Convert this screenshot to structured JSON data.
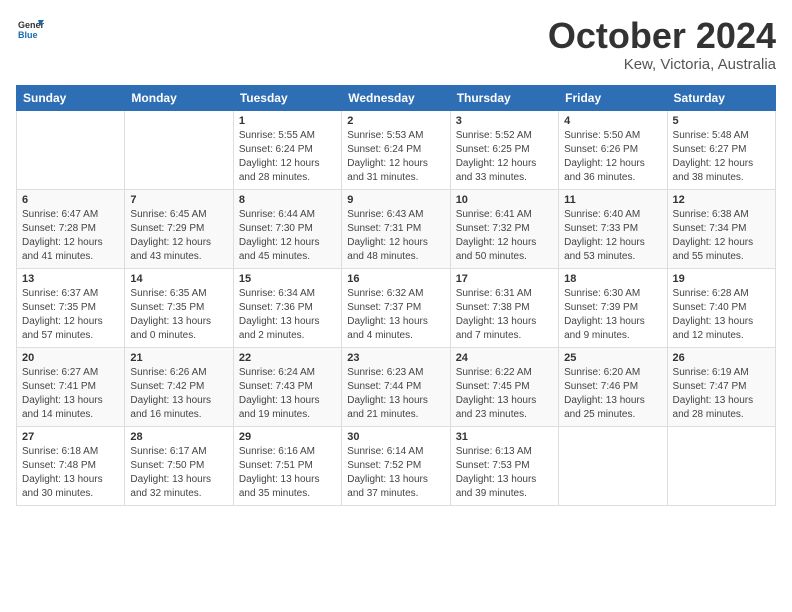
{
  "logo": {
    "general": "General",
    "blue": "Blue"
  },
  "header": {
    "month": "October 2024",
    "location": "Kew, Victoria, Australia"
  },
  "days_of_week": [
    "Sunday",
    "Monday",
    "Tuesday",
    "Wednesday",
    "Thursday",
    "Friday",
    "Saturday"
  ],
  "weeks": [
    [
      {
        "day": "",
        "sunrise": "",
        "sunset": "",
        "daylight": ""
      },
      {
        "day": "",
        "sunrise": "",
        "sunset": "",
        "daylight": ""
      },
      {
        "day": "1",
        "sunrise": "Sunrise: 5:55 AM",
        "sunset": "Sunset: 6:24 PM",
        "daylight": "Daylight: 12 hours and 28 minutes."
      },
      {
        "day": "2",
        "sunrise": "Sunrise: 5:53 AM",
        "sunset": "Sunset: 6:24 PM",
        "daylight": "Daylight: 12 hours and 31 minutes."
      },
      {
        "day": "3",
        "sunrise": "Sunrise: 5:52 AM",
        "sunset": "Sunset: 6:25 PM",
        "daylight": "Daylight: 12 hours and 33 minutes."
      },
      {
        "day": "4",
        "sunrise": "Sunrise: 5:50 AM",
        "sunset": "Sunset: 6:26 PM",
        "daylight": "Daylight: 12 hours and 36 minutes."
      },
      {
        "day": "5",
        "sunrise": "Sunrise: 5:48 AM",
        "sunset": "Sunset: 6:27 PM",
        "daylight": "Daylight: 12 hours and 38 minutes."
      }
    ],
    [
      {
        "day": "6",
        "sunrise": "Sunrise: 6:47 AM",
        "sunset": "Sunset: 7:28 PM",
        "daylight": "Daylight: 12 hours and 41 minutes."
      },
      {
        "day": "7",
        "sunrise": "Sunrise: 6:45 AM",
        "sunset": "Sunset: 7:29 PM",
        "daylight": "Daylight: 12 hours and 43 minutes."
      },
      {
        "day": "8",
        "sunrise": "Sunrise: 6:44 AM",
        "sunset": "Sunset: 7:30 PM",
        "daylight": "Daylight: 12 hours and 45 minutes."
      },
      {
        "day": "9",
        "sunrise": "Sunrise: 6:43 AM",
        "sunset": "Sunset: 7:31 PM",
        "daylight": "Daylight: 12 hours and 48 minutes."
      },
      {
        "day": "10",
        "sunrise": "Sunrise: 6:41 AM",
        "sunset": "Sunset: 7:32 PM",
        "daylight": "Daylight: 12 hours and 50 minutes."
      },
      {
        "day": "11",
        "sunrise": "Sunrise: 6:40 AM",
        "sunset": "Sunset: 7:33 PM",
        "daylight": "Daylight: 12 hours and 53 minutes."
      },
      {
        "day": "12",
        "sunrise": "Sunrise: 6:38 AM",
        "sunset": "Sunset: 7:34 PM",
        "daylight": "Daylight: 12 hours and 55 minutes."
      }
    ],
    [
      {
        "day": "13",
        "sunrise": "Sunrise: 6:37 AM",
        "sunset": "Sunset: 7:35 PM",
        "daylight": "Daylight: 12 hours and 57 minutes."
      },
      {
        "day": "14",
        "sunrise": "Sunrise: 6:35 AM",
        "sunset": "Sunset: 7:35 PM",
        "daylight": "Daylight: 13 hours and 0 minutes."
      },
      {
        "day": "15",
        "sunrise": "Sunrise: 6:34 AM",
        "sunset": "Sunset: 7:36 PM",
        "daylight": "Daylight: 13 hours and 2 minutes."
      },
      {
        "day": "16",
        "sunrise": "Sunrise: 6:32 AM",
        "sunset": "Sunset: 7:37 PM",
        "daylight": "Daylight: 13 hours and 4 minutes."
      },
      {
        "day": "17",
        "sunrise": "Sunrise: 6:31 AM",
        "sunset": "Sunset: 7:38 PM",
        "daylight": "Daylight: 13 hours and 7 minutes."
      },
      {
        "day": "18",
        "sunrise": "Sunrise: 6:30 AM",
        "sunset": "Sunset: 7:39 PM",
        "daylight": "Daylight: 13 hours and 9 minutes."
      },
      {
        "day": "19",
        "sunrise": "Sunrise: 6:28 AM",
        "sunset": "Sunset: 7:40 PM",
        "daylight": "Daylight: 13 hours and 12 minutes."
      }
    ],
    [
      {
        "day": "20",
        "sunrise": "Sunrise: 6:27 AM",
        "sunset": "Sunset: 7:41 PM",
        "daylight": "Daylight: 13 hours and 14 minutes."
      },
      {
        "day": "21",
        "sunrise": "Sunrise: 6:26 AM",
        "sunset": "Sunset: 7:42 PM",
        "daylight": "Daylight: 13 hours and 16 minutes."
      },
      {
        "day": "22",
        "sunrise": "Sunrise: 6:24 AM",
        "sunset": "Sunset: 7:43 PM",
        "daylight": "Daylight: 13 hours and 19 minutes."
      },
      {
        "day": "23",
        "sunrise": "Sunrise: 6:23 AM",
        "sunset": "Sunset: 7:44 PM",
        "daylight": "Daylight: 13 hours and 21 minutes."
      },
      {
        "day": "24",
        "sunrise": "Sunrise: 6:22 AM",
        "sunset": "Sunset: 7:45 PM",
        "daylight": "Daylight: 13 hours and 23 minutes."
      },
      {
        "day": "25",
        "sunrise": "Sunrise: 6:20 AM",
        "sunset": "Sunset: 7:46 PM",
        "daylight": "Daylight: 13 hours and 25 minutes."
      },
      {
        "day": "26",
        "sunrise": "Sunrise: 6:19 AM",
        "sunset": "Sunset: 7:47 PM",
        "daylight": "Daylight: 13 hours and 28 minutes."
      }
    ],
    [
      {
        "day": "27",
        "sunrise": "Sunrise: 6:18 AM",
        "sunset": "Sunset: 7:48 PM",
        "daylight": "Daylight: 13 hours and 30 minutes."
      },
      {
        "day": "28",
        "sunrise": "Sunrise: 6:17 AM",
        "sunset": "Sunset: 7:50 PM",
        "daylight": "Daylight: 13 hours and 32 minutes."
      },
      {
        "day": "29",
        "sunrise": "Sunrise: 6:16 AM",
        "sunset": "Sunset: 7:51 PM",
        "daylight": "Daylight: 13 hours and 35 minutes."
      },
      {
        "day": "30",
        "sunrise": "Sunrise: 6:14 AM",
        "sunset": "Sunset: 7:52 PM",
        "daylight": "Daylight: 13 hours and 37 minutes."
      },
      {
        "day": "31",
        "sunrise": "Sunrise: 6:13 AM",
        "sunset": "Sunset: 7:53 PM",
        "daylight": "Daylight: 13 hours and 39 minutes."
      },
      {
        "day": "",
        "sunrise": "",
        "sunset": "",
        "daylight": ""
      },
      {
        "day": "",
        "sunrise": "",
        "sunset": "",
        "daylight": ""
      }
    ]
  ]
}
